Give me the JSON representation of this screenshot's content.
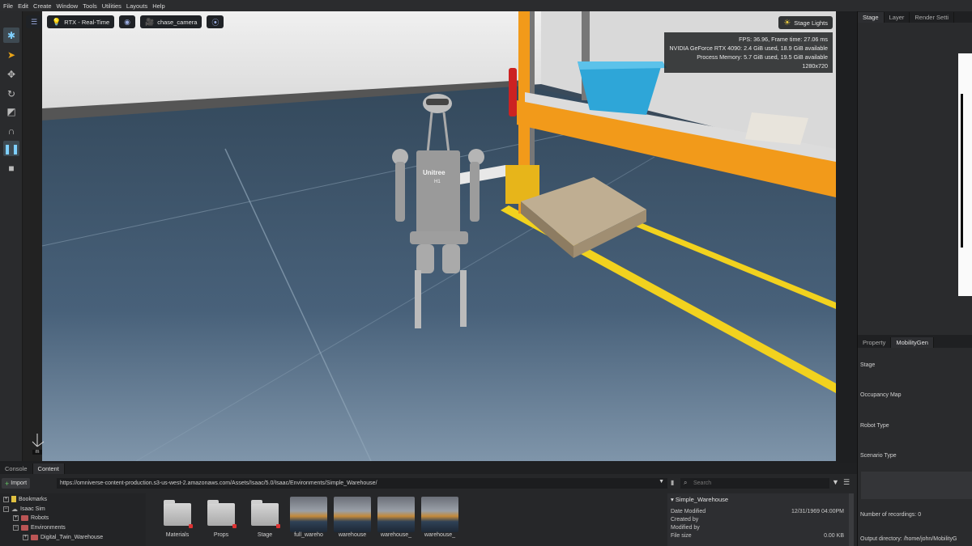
{
  "menu": [
    "File",
    "Edit",
    "Create",
    "Window",
    "Tools",
    "Utilities",
    "Layouts",
    "Help"
  ],
  "viewport": {
    "render_mode": "RTX - Real-Time",
    "camera": "chase_camera",
    "stage_lights": "Stage Lights",
    "perf": {
      "fps": "FPS: 36.96, Frame time: 27.06 ms",
      "gpu": "NVIDIA GeForce RTX 4090: 2.4 GiB used, 18.9 GiB available",
      "memory": "Process Memory: 5.7 GiB used, 19.5 GiB available",
      "resolution": "1280x720"
    },
    "robot_brand": "Unitree",
    "robot_model": "H1",
    "axis_label": "m"
  },
  "right_panel": {
    "tabs": [
      "Stage",
      "Layer",
      "Render Setti"
    ],
    "prop_tabs": [
      "Property",
      "MobilityGen"
    ],
    "rows": {
      "stage": "Stage",
      "occupancy": "Occupancy Map",
      "robot_type": "Robot Type",
      "scenario": "Scenario Type",
      "recordings": "Number of recordings: 0",
      "output": "Output directory: /home/john/MobilityG"
    }
  },
  "bottom": {
    "tabs": [
      "Console",
      "Content"
    ],
    "import": "Import",
    "url": "https://omniverse-content-production.s3-us-west-2.amazonaws.com/Assets/Isaac/5.0/Isaac/Environments/Simple_Warehouse/",
    "search_placeholder": "Search",
    "tree": {
      "bookmarks": "Bookmarks",
      "isaac_sim": "Isaac Sim",
      "robots": "Robots",
      "environments": "Environments",
      "digital_twin": "Digital_Twin_Warehouse"
    },
    "items": [
      "Materials",
      "Props",
      "Stage",
      "full_wareho",
      "warehouse",
      "warehouse_",
      "warehouse_"
    ],
    "details": {
      "title": "Simple_Warehouse",
      "date_label": "Date Modified",
      "date_value": "12/31/1969 04:00PM",
      "created_by": "Created by",
      "modified_by": "Modified by",
      "file_size_label": "File size",
      "file_size_value": "0.00 KB"
    }
  },
  "colors": {
    "floor": "#3f5364",
    "wall": "#e6e6e6",
    "rack_orange": "#f29a1a",
    "bin_blue": "#2ea6d8",
    "yellow_line": "#f2d21e"
  }
}
